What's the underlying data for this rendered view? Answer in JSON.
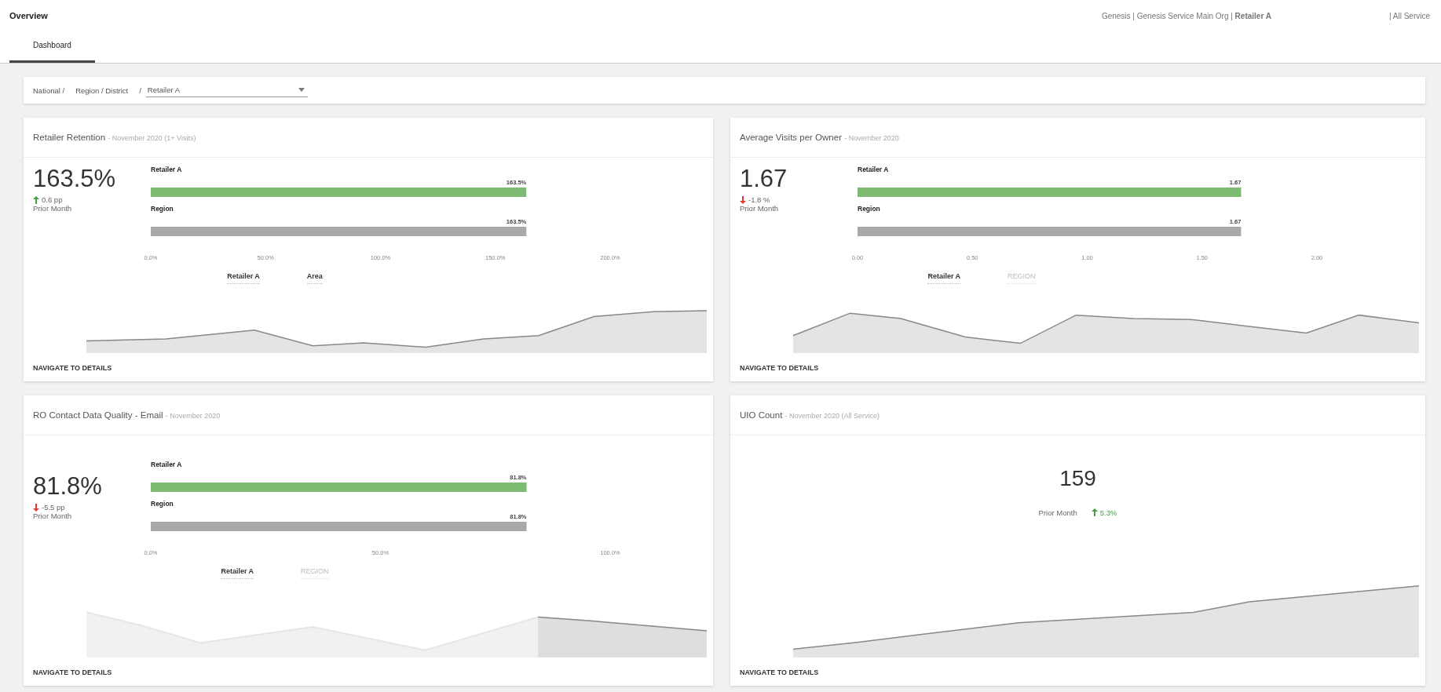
{
  "header": {
    "title": "Overview",
    "breadcrumb": "Genesis | Genesis Service Main Org | **Retailer A**",
    "scope": "| All Service"
  },
  "tabs": [
    {
      "label": "Dashboard",
      "selected": true
    }
  ],
  "filter": {
    "path": [
      "National /",
      "Region / District",
      "/"
    ],
    "dropdown": {
      "value": "Retailer A"
    }
  },
  "cards": [
    {
      "kind": "bars",
      "title": "Retailer Retention",
      "subtitle": "- November 2020 (1+ Visits)",
      "value": "163.5%",
      "delta": {
        "text": "0.6 pp",
        "rising": true
      },
      "delta_label": "Prior Month",
      "chart_data": {
        "type": "bar",
        "orientation": "horizontal",
        "categories": [
          "Retailer A",
          "Region"
        ],
        "series": [
          {
            "color": "#7dbb73",
            "values": [
              163.5,
              null
            ]
          },
          {
            "color": "#a9a9a9",
            "values": [
              null,
              163.5
            ]
          }
        ],
        "xlim": [
          0,
          200
        ],
        "xticks": [
          {
            "value": 0,
            "label": "0.0%"
          },
          {
            "value": 50,
            "label": "50.0%"
          },
          {
            "value": 100,
            "label": "100.0%"
          },
          {
            "value": 150,
            "label": "150.0%"
          },
          {
            "value": 200,
            "label": "200.0%"
          }
        ],
        "value_labels": [
          "163.5%",
          "163.5%"
        ]
      },
      "legend": [
        {
          "label": "Retailer A",
          "selected": true
        },
        {
          "label": "Area",
          "selected": true
        }
      ],
      "link": "NAVIGATE TO DETAILS"
    },
    {
      "kind": "bars",
      "title": "Average Visits per Owner",
      "subtitle": "- November 2020",
      "value": "1.67",
      "delta": {
        "text": "-1.8 %",
        "rising": false
      },
      "delta_label": "Prior Month",
      "chart_data": {
        "type": "bar",
        "orientation": "horizontal",
        "categories": [
          "Retailer A",
          "Region"
        ],
        "series": [
          {
            "color": "#7dbb73",
            "values": [
              1.67,
              null
            ]
          },
          {
            "color": "#a9a9a9",
            "values": [
              null,
              1.67
            ]
          }
        ],
        "xlim": [
          0,
          2
        ],
        "xticks": [
          {
            "value": 0,
            "label": "0.00"
          },
          {
            "value": 0.5,
            "label": "0.50"
          },
          {
            "value": 1,
            "label": "1.00"
          },
          {
            "value": 1.5,
            "label": "1.50"
          },
          {
            "value": 2,
            "label": "2.00"
          }
        ],
        "value_labels": [
          "1.67",
          "1.67"
        ]
      },
      "legend": [
        {
          "label": "Retailer A",
          "selected": true
        },
        {
          "label": "REGION",
          "selected": false
        }
      ],
      "link": "NAVIGATE TO DETAILS"
    },
    {
      "kind": "bars",
      "title": "RO Contact Data Quality - Email",
      "subtitle": "- November 2020",
      "value": "81.8%",
      "delta": {
        "text": "-5.5 pp",
        "rising": false
      },
      "delta_label": "Prior Month",
      "chart_data": {
        "type": "bar",
        "orientation": "horizontal",
        "categories": [
          "Retailer A",
          "Region"
        ],
        "series": [
          {
            "color": "#7dbb73",
            "values": [
              81.8,
              null
            ]
          },
          {
            "color": "#a9a9a9",
            "values": [
              null,
              81.8
            ]
          }
        ],
        "xlim": [
          0,
          100
        ],
        "xticks": [
          {
            "value": 0,
            "label": "0.0%"
          },
          {
            "value": 50,
            "label": "50.0%"
          },
          {
            "value": 100,
            "label": "100.0%"
          }
        ],
        "value_labels": [
          "81.8%",
          "81.8%"
        ]
      },
      "legend": [
        {
          "label": "Retailer A",
          "selected": true
        },
        {
          "label": "REGION",
          "selected": false
        }
      ],
      "link": "NAVIGATE TO DETAILS"
    },
    {
      "kind": "centered",
      "title": "UIO Count",
      "subtitle": "- November 2020 (All Service)",
      "value": "159",
      "delta": {
        "text": "5.3%",
        "rising": true
      },
      "delta_label": "Prior Month",
      "link": "NAVIGATE TO DETAILS"
    }
  ]
}
